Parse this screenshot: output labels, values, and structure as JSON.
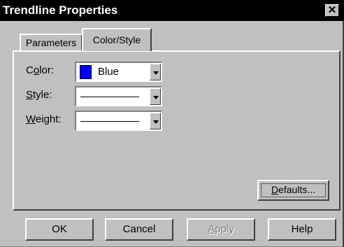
{
  "window": {
    "title": "Trendline Properties",
    "close_glyph": "✕"
  },
  "tabs": [
    {
      "label": "Parameters",
      "selected": false
    },
    {
      "label": "Color/Style",
      "selected": true
    }
  ],
  "fields": {
    "color": {
      "label_pre": "C",
      "label_ul": "o",
      "label_post": "lor:",
      "value": "Blue",
      "swatch": "#0000ff"
    },
    "style": {
      "label_pre": "",
      "label_ul": "S",
      "label_post": "tyle:"
    },
    "weight": {
      "label_pre": "",
      "label_ul": "W",
      "label_post": "eight:"
    }
  },
  "defaults_button": {
    "pre": "",
    "ul": "D",
    "post": "efaults..."
  },
  "buttons": {
    "ok": "OK",
    "cancel": "Cancel",
    "apply_ul": "A",
    "apply_rest": "pply",
    "help": "Help"
  },
  "colors": {
    "face": "#c0c0c0",
    "title_bg": "#000000",
    "accent": "#0000ff"
  }
}
